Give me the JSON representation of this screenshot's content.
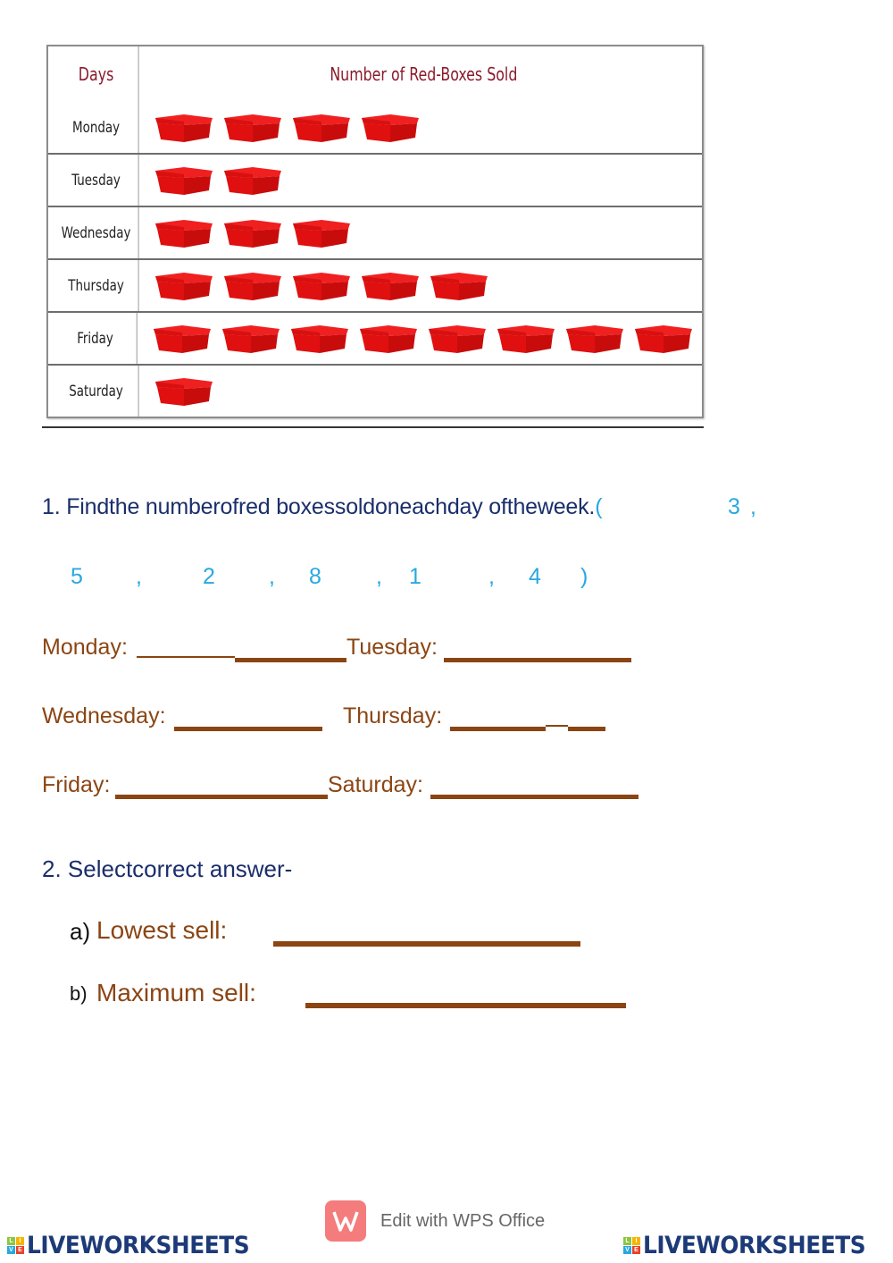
{
  "table": {
    "header_day": "Days",
    "header_count": "Number of Red-Boxes Sold",
    "icon": "red-box-icon",
    "rows": [
      {
        "day": "Monday",
        "count": 4
      },
      {
        "day": "Tuesday",
        "count": 2
      },
      {
        "day": "Wednesday",
        "count": 3
      },
      {
        "day": "Thursday",
        "count": 5
      },
      {
        "day": "Friday",
        "count": 8
      },
      {
        "day": "Saturday",
        "count": 1
      }
    ]
  },
  "chart_data": {
    "type": "table",
    "title": "Number of Red-Boxes Sold",
    "categories": [
      "Monday",
      "Tuesday",
      "Wednesday",
      "Thursday",
      "Friday",
      "Saturday"
    ],
    "values": [
      4,
      2,
      3,
      5,
      8,
      1
    ],
    "xlabel": "Days",
    "ylabel": "Number of Red-Boxes Sold"
  },
  "question1": {
    "text": "1. Findthe numberofred boxessoldoneachday oftheweek.",
    "open_paren": "(",
    "close_paren": ")",
    "answer_options": [
      "3",
      "5",
      "2",
      "8",
      "1",
      "4"
    ],
    "comma": ","
  },
  "fill_blanks": {
    "monday": "Monday:",
    "tuesday": "Tuesday:",
    "wednesday": "Wednesday:",
    "thursday": "Thursday:",
    "friday": "Friday:",
    "saturday": "Saturday:"
  },
  "question2": {
    "text": "2. Selectcorrect answer-",
    "a_marker": "a)",
    "a_label": "Lowest sell:",
    "b_marker": "b)",
    "b_label": "Maximum sell:"
  },
  "footer": {
    "wps_text": "Edit with WPS Office",
    "brand": "LIVEWORKSHEETS",
    "badge_letters": [
      "L",
      "I",
      "V",
      "E"
    ],
    "badge_colors": [
      "#8cc63f",
      "#f7b500",
      "#29a8e0",
      "#e8412c"
    ]
  },
  "colors": {
    "question": "#1a2e6b",
    "answer": "#29a8e0",
    "fill_label": "#8b4513",
    "box_red": "#e01010"
  }
}
